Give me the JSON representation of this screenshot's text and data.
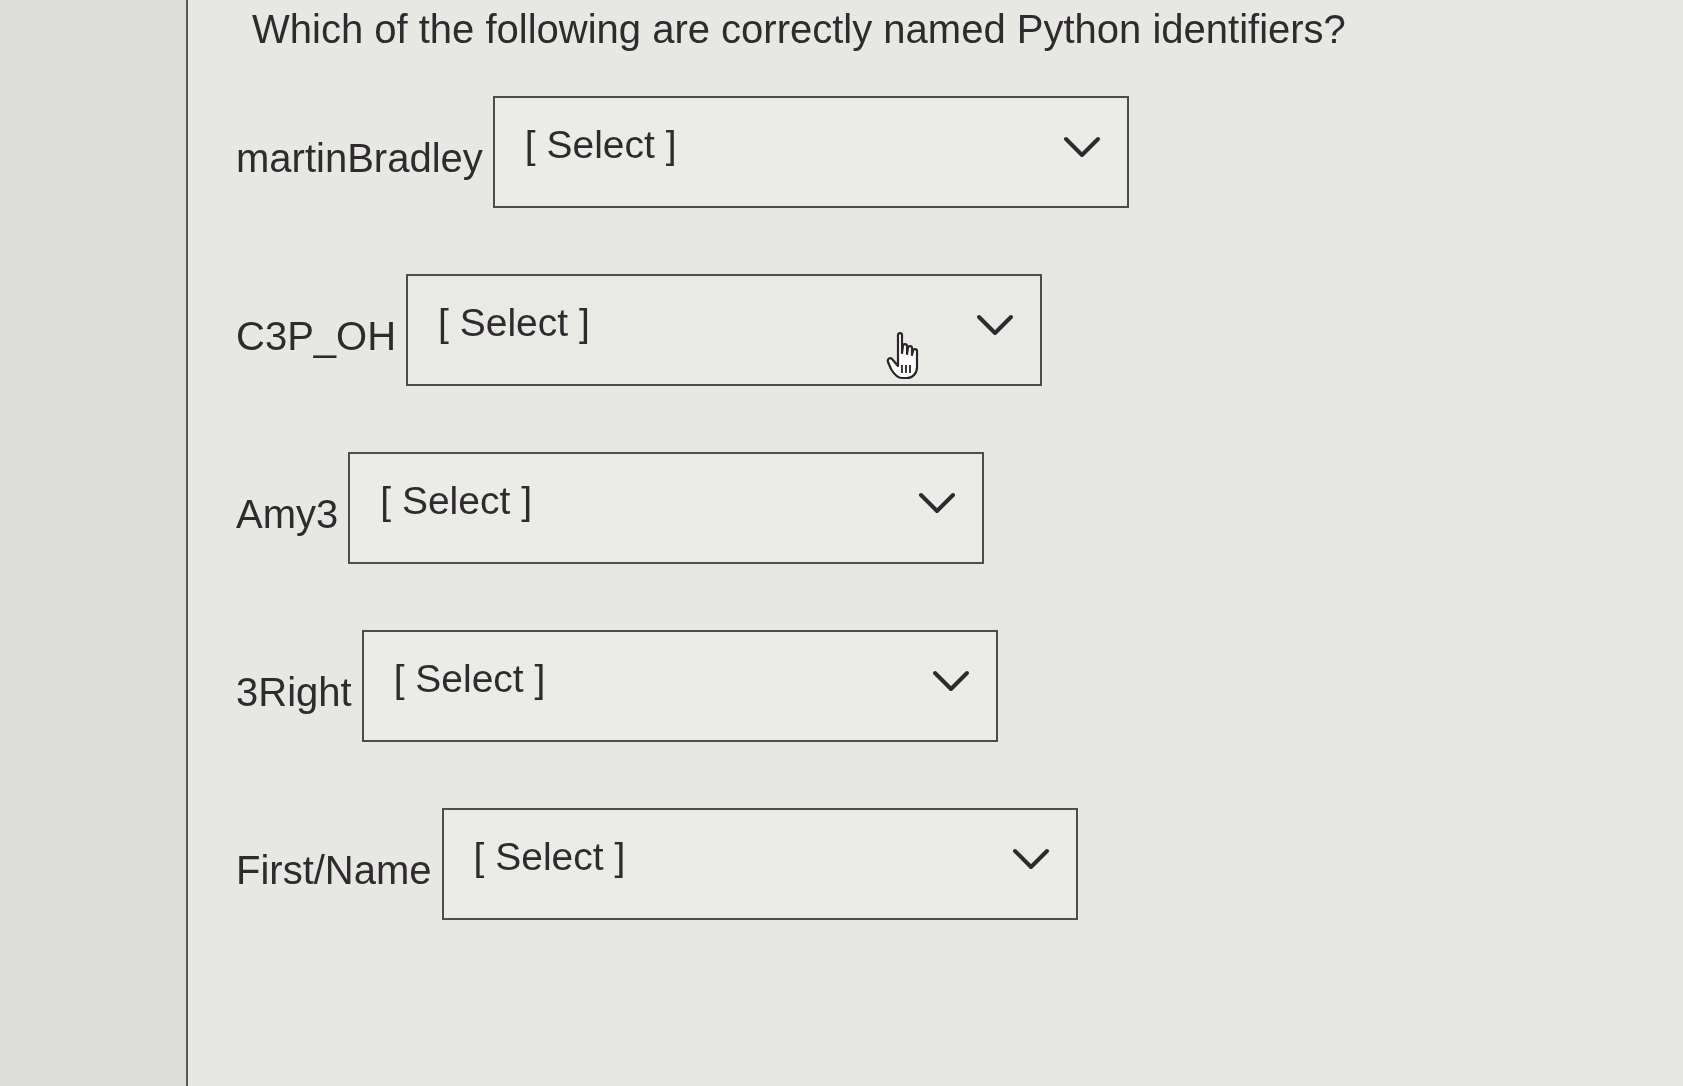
{
  "question": "Which of the following are correctly named Python identifiers?",
  "items": [
    {
      "identifier": "martinBradley",
      "selection": "[ Select ]",
      "hovered": false
    },
    {
      "identifier": "C3P_OH",
      "selection": "[ Select ]",
      "hovered": true
    },
    {
      "identifier": "Amy3",
      "selection": "[ Select ]",
      "hovered": false
    },
    {
      "identifier": "3Right",
      "selection": "[ Select ]",
      "hovered": false
    },
    {
      "identifier": "First/Name",
      "selection": "[ Select ]",
      "hovered": false
    }
  ]
}
